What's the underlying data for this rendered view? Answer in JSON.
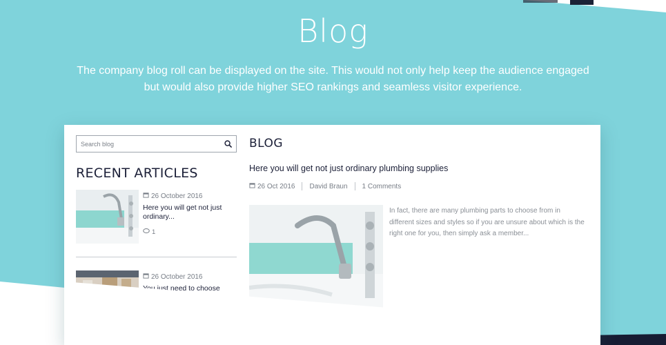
{
  "header": {
    "title": "Blog",
    "subtitle": "The company blog roll can be displayed on the site. This would not only help keep the audience engaged but would also provide higher SEO rankings and seamless visitor experience."
  },
  "sidebar": {
    "search": {
      "placeholder": "Search blog",
      "value": "",
      "icon": "search-icon"
    },
    "recent_title": "RECENT ARTICLES",
    "articles": [
      {
        "date": "26 October 2016",
        "title": "Here you will get not just ordinary...",
        "comments": "1"
      },
      {
        "date": "26 October 2016",
        "title": "You just need to choose"
      }
    ]
  },
  "main": {
    "heading": "BLOG",
    "post": {
      "title": "Here you will get not just ordinary plumbing supplies",
      "date": "26 Oct 2016",
      "author": "David Braun",
      "comments": "1 Comments",
      "excerpt": "In fact, there are many plumbing parts to choose from in different sizes and styles so if you are unsure about which is the right one for you, then simply ask a member..."
    }
  },
  "colors": {
    "background_teal": "#7fd3db",
    "text_dark": "#1c2038",
    "text_muted": "#777d86",
    "accent_dark": "#171c33"
  }
}
